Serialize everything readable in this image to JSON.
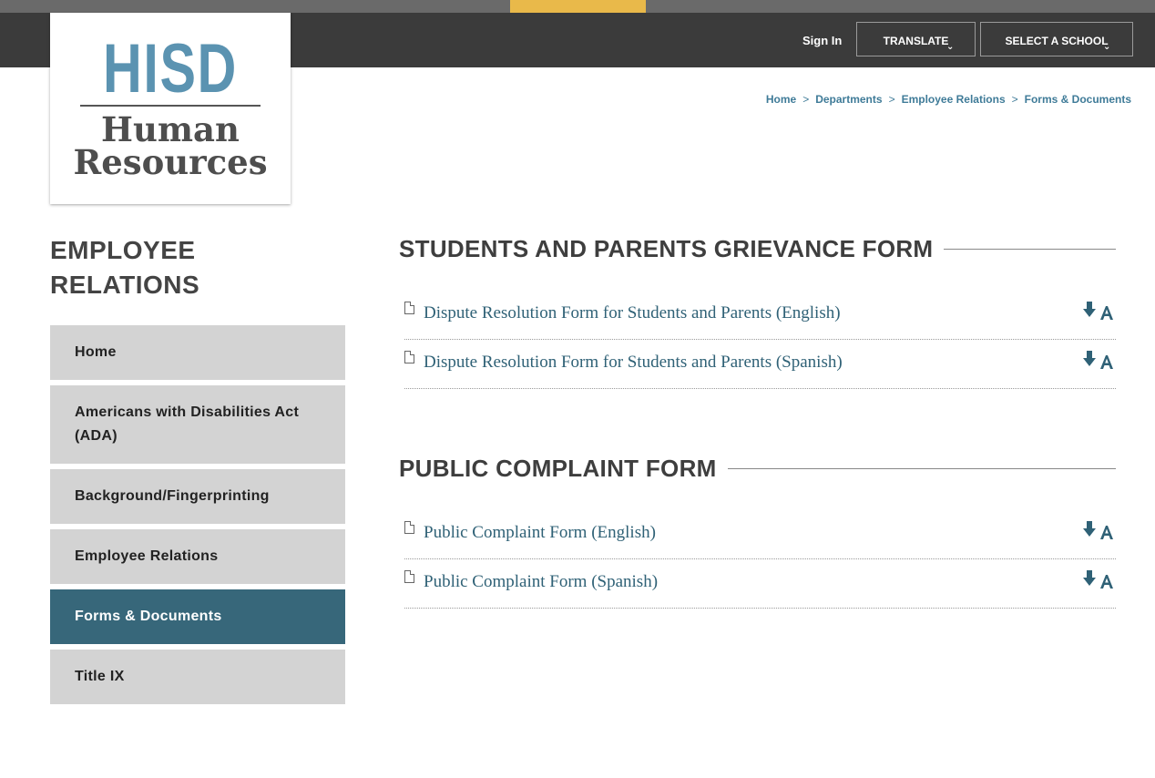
{
  "header": {
    "sign_in": "Sign In",
    "translate": "TRANSLATE",
    "select_school": "SELECT A SCHOOL",
    "accent_color": "#e9b94a"
  },
  "logo": {
    "line1": "HISD",
    "line2": "Human",
    "line3": "Resources"
  },
  "breadcrumb": [
    "Home",
    "Departments",
    "Employee Relations",
    "Forms & Documents"
  ],
  "sidebar": {
    "title_line1": "EMPLOYEE",
    "title_line2": "RELATIONS",
    "items": [
      {
        "label": "Home"
      },
      {
        "label": "Americans with Disabilities Act (ADA)"
      },
      {
        "label": "Background/Fingerprinting"
      },
      {
        "label": "Employee Relations"
      },
      {
        "label": "Forms & Documents",
        "active": true
      },
      {
        "label": "Title IX"
      }
    ]
  },
  "sections": [
    {
      "title": "STUDENTS AND PARENTS GRIEVANCE FORM",
      "docs": [
        {
          "label": "Dispute Resolution Form for Students and Parents (English)",
          "icon": "pdf-icon"
        },
        {
          "label": "Dispute Resolution Form for Students and Parents (Spanish)",
          "icon": "pdf-icon"
        }
      ]
    },
    {
      "title": "PUBLIC COMPLAINT FORM",
      "docs": [
        {
          "label": "Public Complaint Form (English)",
          "icon": "pdf-icon"
        },
        {
          "label": "Public Complaint Form (Spanish)",
          "icon": "pdf-icon"
        }
      ]
    }
  ],
  "colors": {
    "nav_active": "#37677a",
    "link": "#2f6176",
    "logo_blue": "#5b93b1"
  }
}
